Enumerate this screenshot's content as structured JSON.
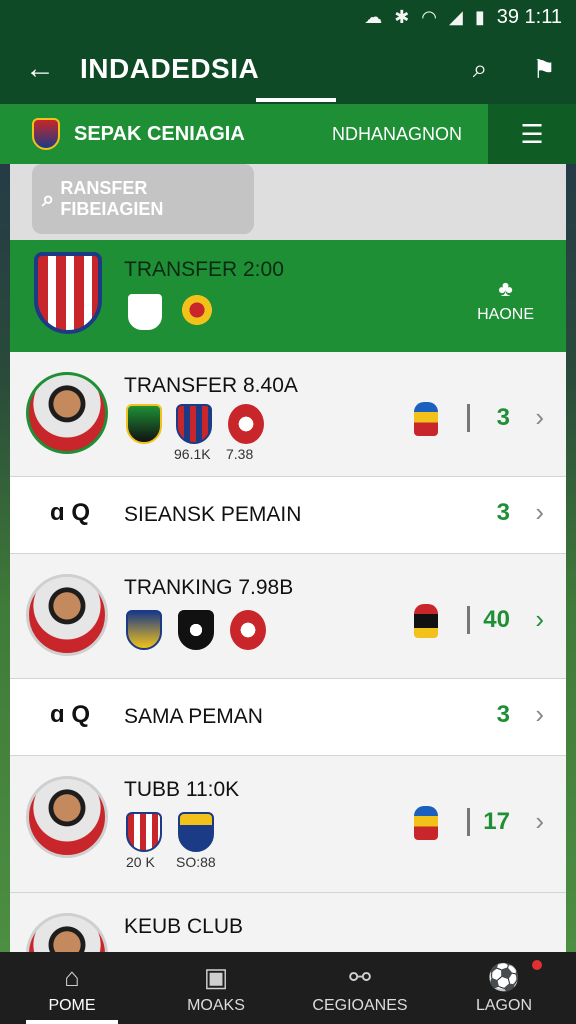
{
  "status_bar": {
    "time": "39 1:11"
  },
  "app_bar": {
    "title": "INDADEDSIA"
  },
  "sub_bar": {
    "league": "SEPAK CENIAGIA",
    "region": "NDHANAGNON"
  },
  "search": {
    "placeholder": "RANSFER FIBEIAGIEN"
  },
  "featured": {
    "title": "TRANSFER 2:00",
    "home_label": "HAONE"
  },
  "rows": [
    {
      "title": "TRANSFER 8.40A",
      "stat1": "96.1K",
      "stat2": "7.38",
      "count": "3"
    },
    {
      "label": "SIEANSK PEMAIN",
      "count": "3"
    },
    {
      "title": "TRANKING 7.98B",
      "count": "40"
    },
    {
      "label": "SAMA PEMAN",
      "count": "3"
    },
    {
      "title": "TUBB 11:0K",
      "stat1": "20 K",
      "stat2": "SO:88",
      "count": "17"
    },
    {
      "title": "KEUB CLUB"
    }
  ],
  "bottom_nav": [
    {
      "label": "POME"
    },
    {
      "label": "MOAKS"
    },
    {
      "label": "CEGIOANES"
    },
    {
      "label": "LAGON"
    }
  ],
  "colors": {
    "primary_dark": "#0e4a25",
    "primary": "#1f8f36",
    "accent_red": "#e23030"
  }
}
